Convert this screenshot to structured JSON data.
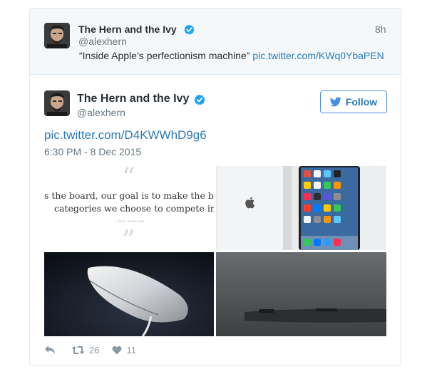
{
  "parent_tweet": {
    "author_name": "The Hern and the Ivy",
    "handle": "@alexhern",
    "time": "8h",
    "text": "“Inside Apple’s perfectionism machine”",
    "link": "pic.twitter.com/KWq0YbaPEN"
  },
  "main_tweet": {
    "author_name": "The Hern and the Ivy",
    "handle": "@alexhern",
    "follow_label": "Follow",
    "link": "pic.twitter.com/D4KWWhD9g6",
    "timestamp": "6:30 PM - 8 Dec 2015",
    "media": {
      "quote_line1": "s the board, our goal is to make the best i",
      "quote_line2": "categories we choose to compete in.",
      "quote_attribution": "— PHIL SCHILLER"
    },
    "actions": {
      "retweets": "26",
      "likes": "11"
    }
  },
  "colors": {
    "link": "#2b7bb9",
    "verified": "#1da1f2",
    "muted": "#66757f",
    "border": "#e1e8ed",
    "parent_bg": "#f5f8fa"
  }
}
